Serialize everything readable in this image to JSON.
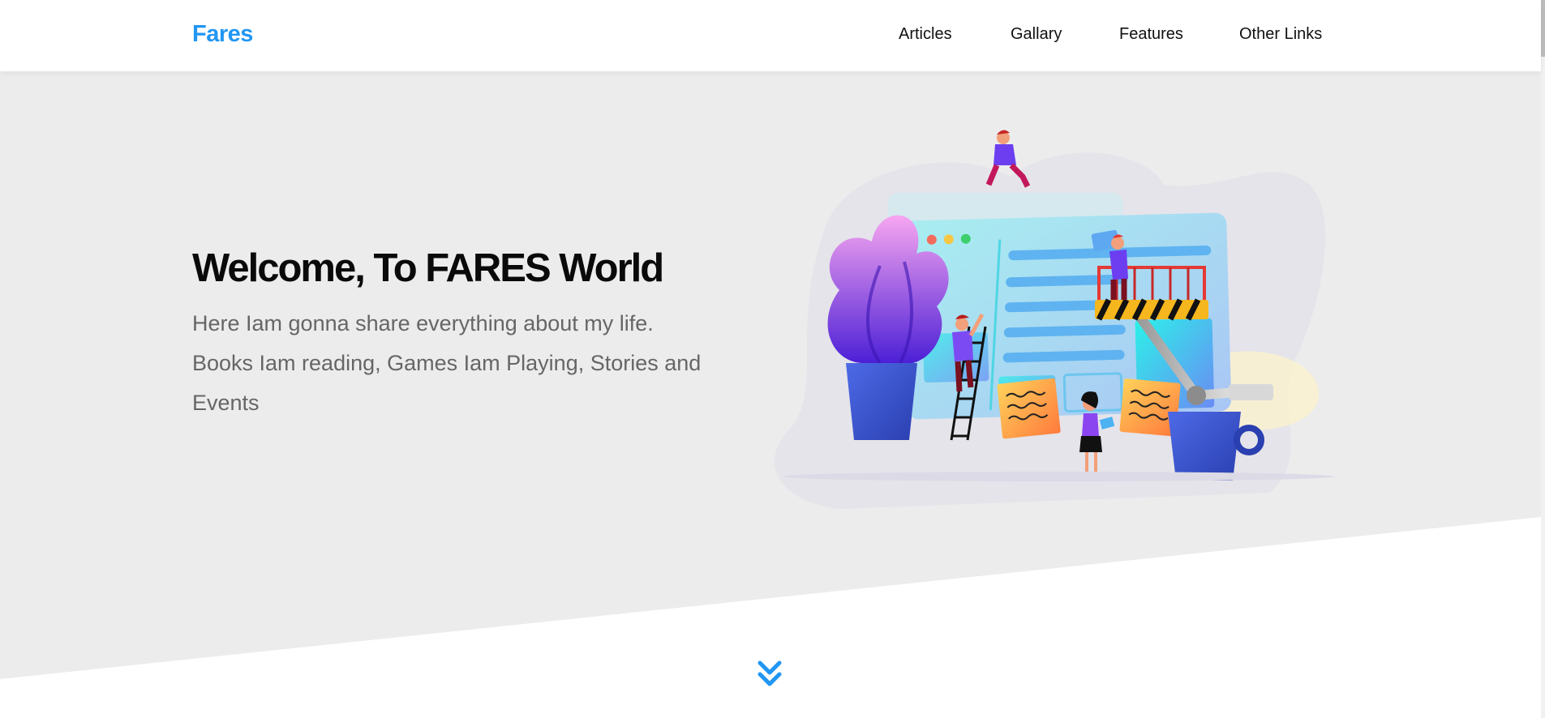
{
  "header": {
    "logo": "Fares",
    "nav": [
      "Articles",
      "Gallary",
      "Features",
      "Other Links"
    ]
  },
  "landing": {
    "title": "Welcome, To FARES World",
    "text": "Here Iam gonna share everything about my life. Books Iam reading, Games Iam Playing, Stories and Events"
  },
  "icons": {
    "go_down": "double-chevron-down-icon"
  },
  "colors": {
    "accent": "#2196f3",
    "landing_bg": "#ececec",
    "text_muted": "#666666"
  }
}
